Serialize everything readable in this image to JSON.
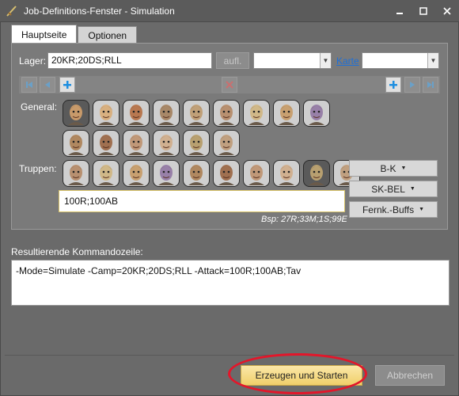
{
  "window": {
    "title": "Job-Definitions-Fenster - Simulation",
    "minimize_icon": "minimize-icon",
    "restore_icon": "restore-icon",
    "close_icon": "close-icon"
  },
  "tabs": [
    {
      "label": "Hauptseite",
      "active": true
    },
    {
      "label": "Optionen",
      "active": false
    }
  ],
  "camp": {
    "label": "Lager:",
    "value": "20KR;20DS;RLL",
    "aufl_label": "aufl.",
    "combo1_value": "",
    "karte_link": "Karte",
    "combo2_value": ""
  },
  "general": {
    "label": "General:",
    "count": 15
  },
  "troops": {
    "label": "Truppen:",
    "count": 10,
    "input_value": "100R;100AB",
    "example": "Bsp: 27R;33M;1S;99E",
    "buttons": [
      {
        "label": "B-K"
      },
      {
        "label": "SK-BEL"
      },
      {
        "label": "Fernk.-Buffs"
      }
    ]
  },
  "result": {
    "label": "Resultierende Kommandozeile:",
    "text": "-Mode=Simulate -Camp=20KR;20DS;RLL -Attack=100R;100AB;Tav"
  },
  "actions": {
    "primary_label": "Erzeugen und Starten",
    "cancel_label": "Abbrechen"
  },
  "colors": {
    "background": "#6a6a6a",
    "titlebar": "#5b5b5b",
    "accent_blue": "#1f8fe0",
    "link_blue": "#1f6fd6",
    "highlight_red": "#e3162a",
    "primary_button": "#f0cf6a"
  }
}
